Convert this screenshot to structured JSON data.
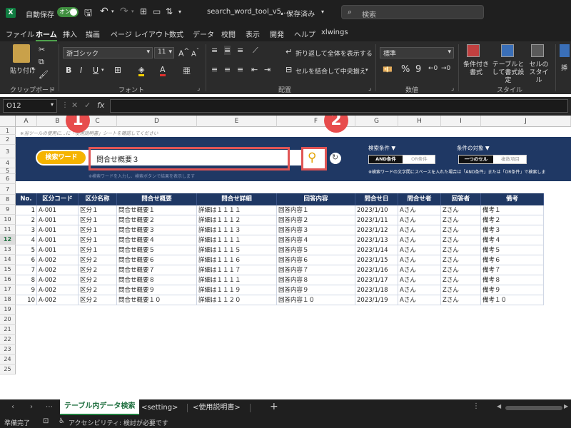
{
  "titlebar": {
    "autosave_label": "自動保存",
    "autosave_state": "オン",
    "filename": "search_word_tool_v5.…",
    "saved_state": "• 保存済み",
    "search_placeholder": "検索"
  },
  "menu": [
    "ファイル",
    "ホーム",
    "挿入",
    "描画",
    "ページ レイアウト",
    "数式",
    "データ",
    "校閲",
    "表示",
    "開発",
    "ヘルプ",
    "xlwings"
  ],
  "ribbon": {
    "paste_label": "貼り付け",
    "clipboard_group": "クリップボード",
    "font_group": "フォント",
    "font_name": "游ゴシック",
    "font_size": "11",
    "align_group": "配置",
    "wrap_text": "折り返して全体を表示する",
    "merge_center": "セルを結合して中央揃え",
    "number_group": "数値",
    "number_format": "標準",
    "style_group": "スタイル",
    "cond_format": "条件付き書式",
    "table_format": "テーブルとして書式設定",
    "cell_style": "セルのスタイル",
    "insert_label": "挿"
  },
  "formula_bar": {
    "name_box": "O12",
    "fx": "fx",
    "content": ""
  },
  "columns": [
    "A",
    "B",
    "C",
    "D",
    "E",
    "F",
    "G",
    "H",
    "I",
    "J"
  ],
  "rows": [
    "1",
    "2",
    "3",
    "4",
    "5",
    "6",
    "7",
    "8",
    "9",
    "10",
    "11",
    "12",
    "13",
    "14",
    "15",
    "16",
    "17",
    "18",
    "19",
    "20",
    "21",
    "22",
    "23",
    "24",
    "25"
  ],
  "banner": {
    "note": "※当ツールの使用に…に「使用説明書」シートを確認してください",
    "search_word_label": "検索ワード",
    "search_word_value": "問合せ概要３",
    "note_row4": "※検索ワードを入力し、検索ボタンで結果を表示します",
    "condition_label": "検索条件 ▼",
    "and_label": "AND条件",
    "or_label": "OR条件",
    "target_label": "条件の対象 ▼",
    "one_cell": "一つのセル",
    "multi_items": "複数項目",
    "space_note": "※検索ワードの文字間にスペースを入れた場合は「AND条件」または「OR条件」で検索しま"
  },
  "badges": [
    "1",
    "2"
  ],
  "table": {
    "headers": [
      "No.",
      "区分コード",
      "区分名称",
      "問合せ概要",
      "問合せ詳細",
      "回答内容",
      "問合せ日",
      "問合せ者",
      "回答者",
      "備考"
    ],
    "rows": [
      [
        "1",
        "A-001",
        "区分１",
        "問合せ概要１",
        "詳細は１１１１",
        "回答内容１",
        "2023/1/10",
        "Aさん",
        "Zさん",
        "備考１"
      ],
      [
        "2",
        "A-001",
        "区分１",
        "問合せ概要２",
        "詳細は１１１２",
        "回答内容２",
        "2023/1/11",
        "Aさん",
        "Zさん",
        "備考２"
      ],
      [
        "3",
        "A-001",
        "区分１",
        "問合せ概要３",
        "詳細は１１１３",
        "回答内容３",
        "2023/1/12",
        "Aさん",
        "Zさん",
        "備考３"
      ],
      [
        "4",
        "A-001",
        "区分１",
        "問合せ概要４",
        "詳細は１１１１",
        "回答内容４",
        "2023/1/13",
        "Aさん",
        "Zさん",
        "備考４"
      ],
      [
        "5",
        "A-001",
        "区分１",
        "問合せ概要５",
        "詳細は１１１５",
        "回答内容５",
        "2023/1/14",
        "Aさん",
        "Zさん",
        "備考５"
      ],
      [
        "6",
        "A-002",
        "区分２",
        "問合せ概要６",
        "詳細は１１１６",
        "回答内容６",
        "2023/1/15",
        "Aさん",
        "Zさん",
        "備考６"
      ],
      [
        "7",
        "A-002",
        "区分２",
        "問合せ概要７",
        "詳細は１１１７",
        "回答内容７",
        "2023/1/16",
        "Aさん",
        "Zさん",
        "備考７"
      ],
      [
        "8",
        "A-002",
        "区分２",
        "問合せ概要８",
        "詳細は１１１１",
        "回答内容８",
        "2023/1/17",
        "Aさん",
        "Zさん",
        "備考８"
      ],
      [
        "9",
        "A-002",
        "区分２",
        "問合せ概要９",
        "詳細は１１１９",
        "回答内容９",
        "2023/1/18",
        "Aさん",
        "Zさん",
        "備考９"
      ],
      [
        "10",
        "A-002",
        "区分２",
        "問合せ概要１０",
        "詳細は１１２０",
        "回答内容１０",
        "2023/1/19",
        "Aさん",
        "Zさん",
        "備考１０"
      ]
    ]
  },
  "sheet_tabs": [
    "テーブル内データ検索",
    "<setting>",
    "<使用説明書>"
  ],
  "status": {
    "ready": "準備完了",
    "accessibility": "アクセシビリティ: 検討が必要です"
  }
}
